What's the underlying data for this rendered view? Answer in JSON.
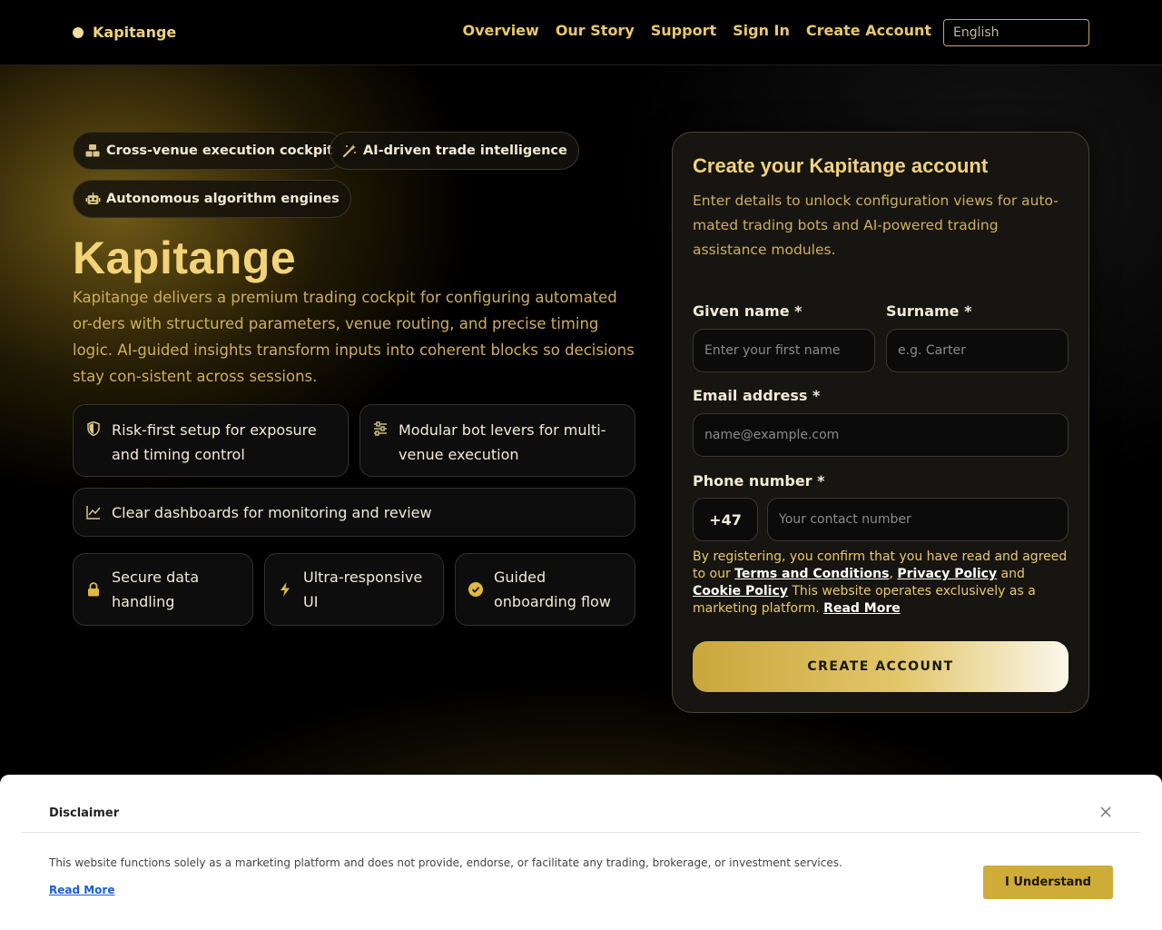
{
  "header": {
    "brand": "Kapitange",
    "nav": [
      "Overview",
      "Our Story",
      "Support",
      "Sign In",
      "Create Account"
    ],
    "language": "English"
  },
  "hero": {
    "chips": [
      {
        "label": "Cross-venue execution cockpit",
        "icon": "cubes-icon"
      },
      {
        "label": "AI-driven trade intelligence",
        "icon": "magic-wand-icon"
      },
      {
        "label": "Autonomous algorithm engines",
        "icon": "robot-icon"
      }
    ],
    "title": "Kapitange",
    "description": "Kapitange delivers a premium trading cockpit for configuring automated or-ders with structured parameters, venue routing, and precise timing logic. AI-guided insights transform inputs into coherent blocks so decisions stay con-sistent across sessions.",
    "features": [
      {
        "label": "Risk-first setup for exposure and timing control",
        "icon": "shield-icon"
      },
      {
        "label": "Modular bot levers for multi-venue execution",
        "icon": "sliders-icon"
      },
      {
        "label": "Clear dashboards for monitoring and review",
        "icon": "chart-line-icon"
      }
    ],
    "highlights": [
      {
        "label": "Secure data handling",
        "icon": "lock-icon"
      },
      {
        "label": "Ultra-responsive UI",
        "icon": "lightning-icon"
      },
      {
        "label": "Guided onboarding flow",
        "icon": "check-circle-icon"
      }
    ]
  },
  "form": {
    "title": "Create your Kapitange account",
    "description": "Enter details to unlock configuration views for auto-mated trading bots and AI-powered trading assistance modules.",
    "given_name_label": "Given name *",
    "given_name_placeholder": "Enter your first name",
    "surname_label": "Surname *",
    "surname_placeholder": "e.g. Carter",
    "email_label": "Email address *",
    "email_placeholder": "name@example.com",
    "phone_label": "Phone number *",
    "phone_prefix": "+47",
    "phone_placeholder": "Your contact number",
    "terms_pre": "By registering, you confirm that you have read and agreed to our ",
    "terms_link": "Terms and Conditions",
    "terms_sep": ", ",
    "privacy_link": "Privacy Policy",
    "terms_and": " and ",
    "cookie_link": "Cookie Policy",
    "marketing_note": " This website operates exclusively as a marketing platform. ",
    "read_more": "Read More",
    "submit": "CREATE ACCOUNT"
  },
  "disclaimer": {
    "title": "Disclaimer",
    "text": "This website functions solely as a marketing platform and does not provide, endorse, or facilitate any trading, brokerage, or investment services.",
    "read_more": "Read More",
    "button": "I Understand"
  },
  "colors": {
    "accent": "#f2d27a",
    "gold_text": "#cfae5e",
    "button_gold": "#cfab38"
  }
}
